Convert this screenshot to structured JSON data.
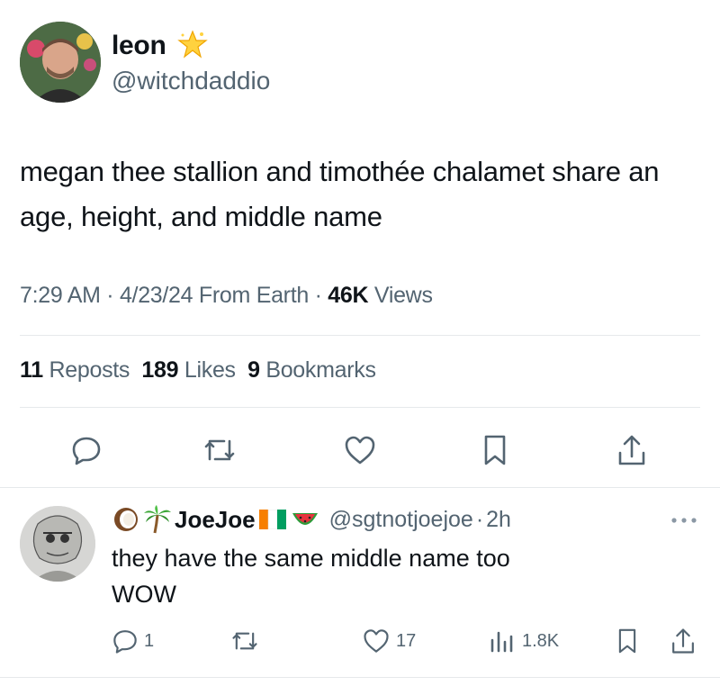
{
  "tweet": {
    "author_name": "leon",
    "author_handle": "@witchdaddio",
    "text": "megan thee stallion and timothée chalamet share an age, height, and middle name",
    "time": "7:29 AM",
    "date": "4/23/24",
    "location": "From Earth",
    "views_count": "46K",
    "views_label": "Views",
    "reposts_count": "11",
    "reposts_label": "Reposts",
    "likes_count": "189",
    "likes_label": "Likes",
    "bookmarks_count": "9",
    "bookmarks_label": "Bookmarks"
  },
  "reply": {
    "author_name": "JoeJoe",
    "author_handle": "@sgtnotjoejoe",
    "age": "2h",
    "text_line1": "they have the same middle name too",
    "text_line2": "WOW",
    "replies": "1",
    "likes": "17",
    "views": "1.8K"
  },
  "colors": {
    "text": "#0f1419",
    "secondary": "#536471",
    "divider": "#e6e9eb"
  }
}
